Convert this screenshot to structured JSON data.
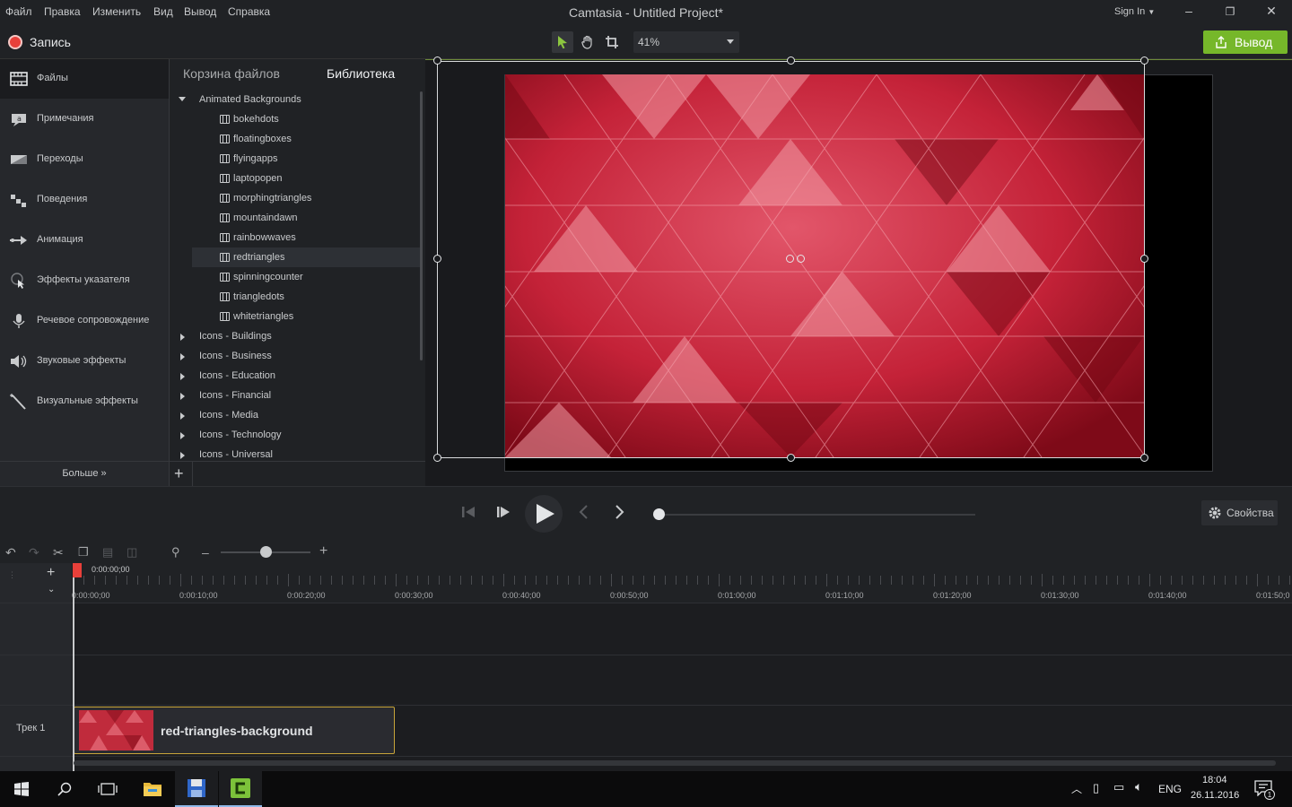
{
  "menu": {
    "items": [
      "Файл",
      "Правка",
      "Изменить",
      "Вид",
      "Вывод",
      "Справка"
    ],
    "title": "Camtasia - Untitled Project*",
    "sign_in": "Sign In"
  },
  "toolbar": {
    "record_label": "Запись",
    "zoom_value": "41%",
    "export_label": "Вывод",
    "accent_color": "#76b72a"
  },
  "sidebar": {
    "items": [
      {
        "label": "Файлы",
        "icon": "film-strip-icon"
      },
      {
        "label": "Примечания",
        "icon": "annotation-icon"
      },
      {
        "label": "Переходы",
        "icon": "transition-icon"
      },
      {
        "label": "Поведения",
        "icon": "behavior-icon"
      },
      {
        "label": "Анимация",
        "icon": "animation-arrow-icon"
      },
      {
        "label": "Эффекты указателя",
        "icon": "cursor-effects-icon"
      },
      {
        "label": "Речевое сопровождение",
        "icon": "microphone-icon"
      },
      {
        "label": "Звуковые эффекты",
        "icon": "speaker-icon"
      },
      {
        "label": "Визуальные эффекты",
        "icon": "magic-wand-icon"
      }
    ],
    "more_label": "Больше »"
  },
  "library": {
    "tab_bin": "Корзина файлов",
    "tab_library": "Библиотека",
    "folder_open": "Animated Backgrounds",
    "assets": [
      "bokehdots",
      "floatingboxes",
      "flyingapps",
      "laptopopen",
      "morphingtriangles",
      "mountaindawn",
      "rainbowwaves",
      "redtriangles",
      "spinningcounter",
      "triangledots",
      "whitetriangles"
    ],
    "selected_asset": "redtriangles",
    "folders": [
      "Icons - Buildings",
      "Icons - Business",
      "Icons - Education",
      "Icons - Financial",
      "Icons - Media",
      "Icons - Technology",
      "Icons - Universal"
    ]
  },
  "playback": {
    "properties_label": "Свойства"
  },
  "timeline": {
    "playhead_time": "0:00:00;00",
    "ticks": [
      "0:00:00;00",
      "0:00:10;00",
      "0:00:20;00",
      "0:00:30;00",
      "0:00:40;00",
      "0:00:50;00",
      "0:01:00;00",
      "0:01:10;00",
      "0:01:20;00",
      "0:01:30;00",
      "0:01:40;00",
      "0:01:50;0"
    ],
    "track_label": "Трек 1",
    "clip_label": "red-triangles-background"
  },
  "taskbar": {
    "lang": "ENG",
    "time": "18:04",
    "date": "26.11.2016",
    "notification_count": "1"
  }
}
